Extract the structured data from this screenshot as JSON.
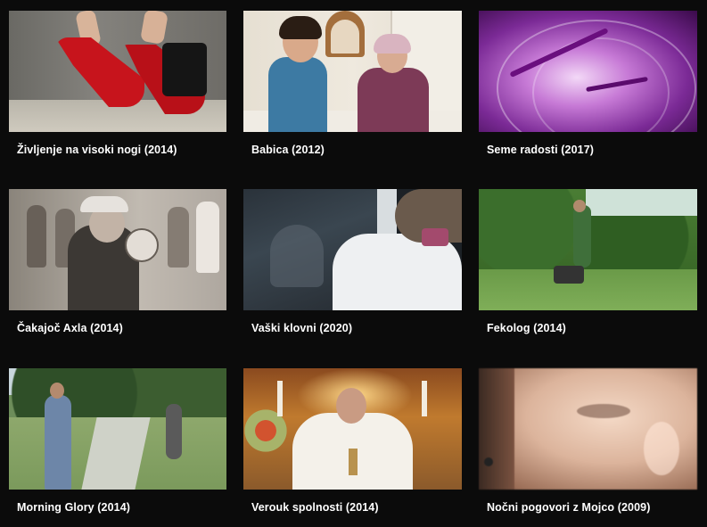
{
  "films": [
    {
      "title": "Življenje na visoki nogi (2014)",
      "thumb": "red-high-heels"
    },
    {
      "title": "Babica (2012)",
      "thumb": "boy-and-grandmother"
    },
    {
      "title": "Seme radosti (2017)",
      "thumb": "purple-onion"
    },
    {
      "title": "Čakajoč Axla (2014)",
      "thumb": "sepia-boy-with-ball"
    },
    {
      "title": "Vaški klovni (2020)",
      "thumb": "car-window-portrait"
    },
    {
      "title": "Fekolog (2014)",
      "thumb": "man-in-garden"
    },
    {
      "title": "Morning Glory (2014)",
      "thumb": "workers-on-garden-path"
    },
    {
      "title": "Verouk spolnosti (2014)",
      "thumb": "priest-at-altar"
    },
    {
      "title": "Nočni pogovori z Mojco (2009)",
      "thumb": "face-close-up"
    }
  ]
}
